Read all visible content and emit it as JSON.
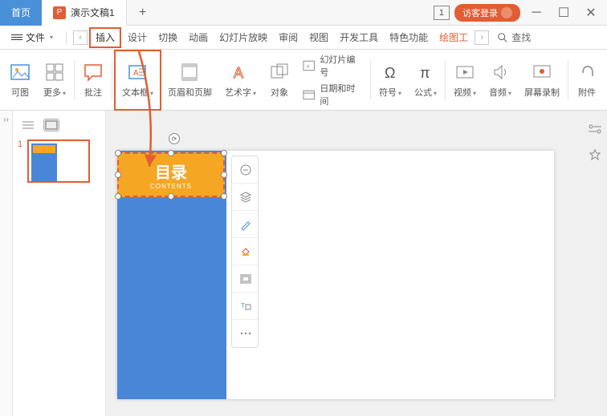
{
  "title_bar": {
    "home_tab": "首页",
    "doc_tab": "演示文稿1",
    "doc_icon": "P",
    "badge": "1",
    "login": "访客登录"
  },
  "menu": {
    "file": "文件",
    "tabs": [
      "插入",
      "设计",
      "切换",
      "动画",
      "幻灯片放映",
      "审阅",
      "视图",
      "开发工具",
      "特色功能",
      "绘图工"
    ],
    "search": "查找"
  },
  "ribbon": {
    "items": [
      {
        "label": "可图"
      },
      {
        "label": "更多"
      },
      {
        "label": "批注"
      },
      {
        "label": "文本框"
      },
      {
        "label": "页眉和页脚"
      },
      {
        "label": "艺术字"
      },
      {
        "label": "对象"
      }
    ],
    "sub": {
      "num": "幻灯片编号",
      "date": "日期和时间"
    },
    "symbol": "符号",
    "formula": "公式",
    "video": "视频",
    "audio": "音频",
    "record": "屏幕录制",
    "attach": "附件"
  },
  "thumb": {
    "num": "1"
  },
  "selected": {
    "title": "目录",
    "sub": "CONTENTS"
  }
}
